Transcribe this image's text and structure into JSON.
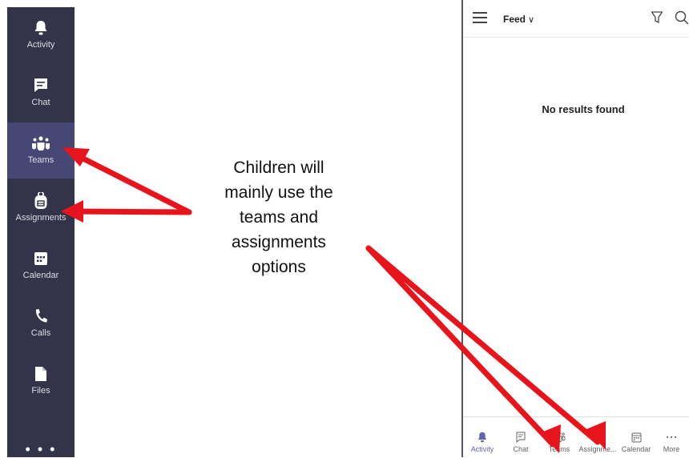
{
  "sidebar": {
    "items": [
      {
        "label": "Activity",
        "icon": "bell-icon"
      },
      {
        "label": "Chat",
        "icon": "chat-icon"
      },
      {
        "label": "Teams",
        "icon": "teams-icon"
      },
      {
        "label": "Assignments",
        "icon": "backpack-icon"
      },
      {
        "label": "Calendar",
        "icon": "calendar-icon"
      },
      {
        "label": "Calls",
        "icon": "phone-icon"
      },
      {
        "label": "Files",
        "icon": "file-icon"
      }
    ],
    "active": "Teams",
    "more": "• • •"
  },
  "annotation": {
    "lines": [
      "Children will",
      "mainly use the",
      "teams and",
      "assignments",
      "options"
    ]
  },
  "phone": {
    "header_title": "Feed",
    "header_chevron": "∨",
    "empty_text": "No results found",
    "tabs": [
      {
        "label": "Activity",
        "icon": "bell-icon",
        "active": true
      },
      {
        "label": "Chat",
        "icon": "chat-icon"
      },
      {
        "label": "Teams",
        "icon": "teams-icon"
      },
      {
        "label": "Assignme...",
        "icon": "backpack-icon"
      },
      {
        "label": "Calendar",
        "icon": "calendar-icon"
      },
      {
        "label": "More",
        "icon": "more-icon"
      }
    ]
  },
  "colors": {
    "sidebar_bg": "#33344a",
    "sidebar_active": "#464775",
    "accent": "#6264a7",
    "arrow": "#e8141c"
  }
}
